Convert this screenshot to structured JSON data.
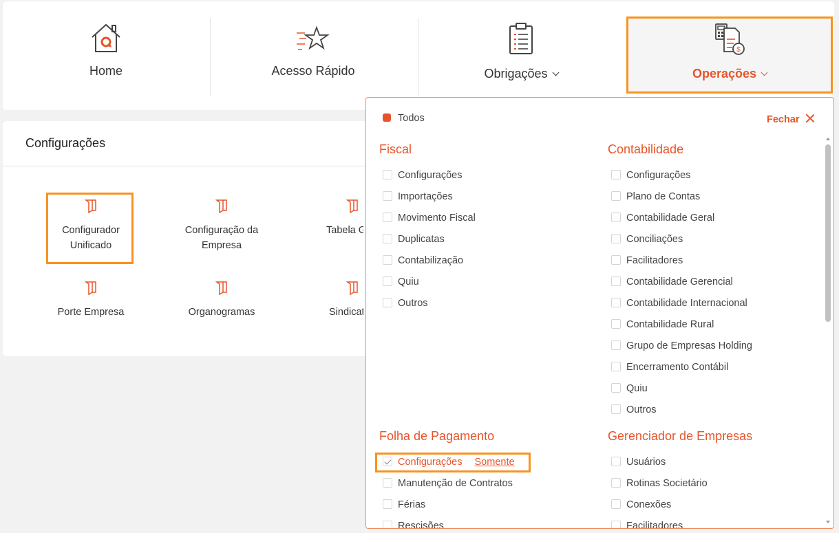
{
  "nav": {
    "home": "Home",
    "acesso_rapido": "Acesso Rápido",
    "obrigacoes": "Obrigações",
    "operacoes": "Operações"
  },
  "config_panel": {
    "title": "Configurações",
    "tiles": [
      {
        "label": "Configurador\nUnificado"
      },
      {
        "label": "Configuração da\nEmpresa"
      },
      {
        "label": "Tabela G"
      },
      {
        "label": "Porte Empresa"
      },
      {
        "label": "Organogramas"
      },
      {
        "label": "Sindicat"
      }
    ]
  },
  "dropdown": {
    "todos": "Todos",
    "fechar": "Fechar",
    "fiscal": {
      "title": "Fiscal",
      "items": [
        "Configurações",
        "Importações",
        "Movimento Fiscal",
        "Duplicatas",
        "Contabilização",
        "Quiu",
        "Outros"
      ]
    },
    "contabilidade": {
      "title": "Contabilidade",
      "items": [
        "Configurações",
        "Plano de Contas",
        "Contabilidade Geral",
        "Conciliações",
        "Facilitadores",
        "Contabilidade Gerencial",
        "Contabilidade Internacional",
        "Contabilidade Rural",
        "Grupo de Empresas Holding",
        "Encerramento Contábil",
        "Quiu",
        "Outros"
      ]
    },
    "folha": {
      "title": "Folha de Pagamento",
      "items": [
        "Configurações",
        "Manutenção de Contratos",
        "Férias",
        "Rescisões"
      ],
      "somente": "Somente"
    },
    "gerenciador": {
      "title": "Gerenciador de Empresas",
      "items": [
        "Usuários",
        "Rotinas Societário",
        "Conexões",
        "Facilitadores"
      ]
    }
  },
  "colors": {
    "accent": "#e8542a",
    "highlight": "#f7931e"
  }
}
